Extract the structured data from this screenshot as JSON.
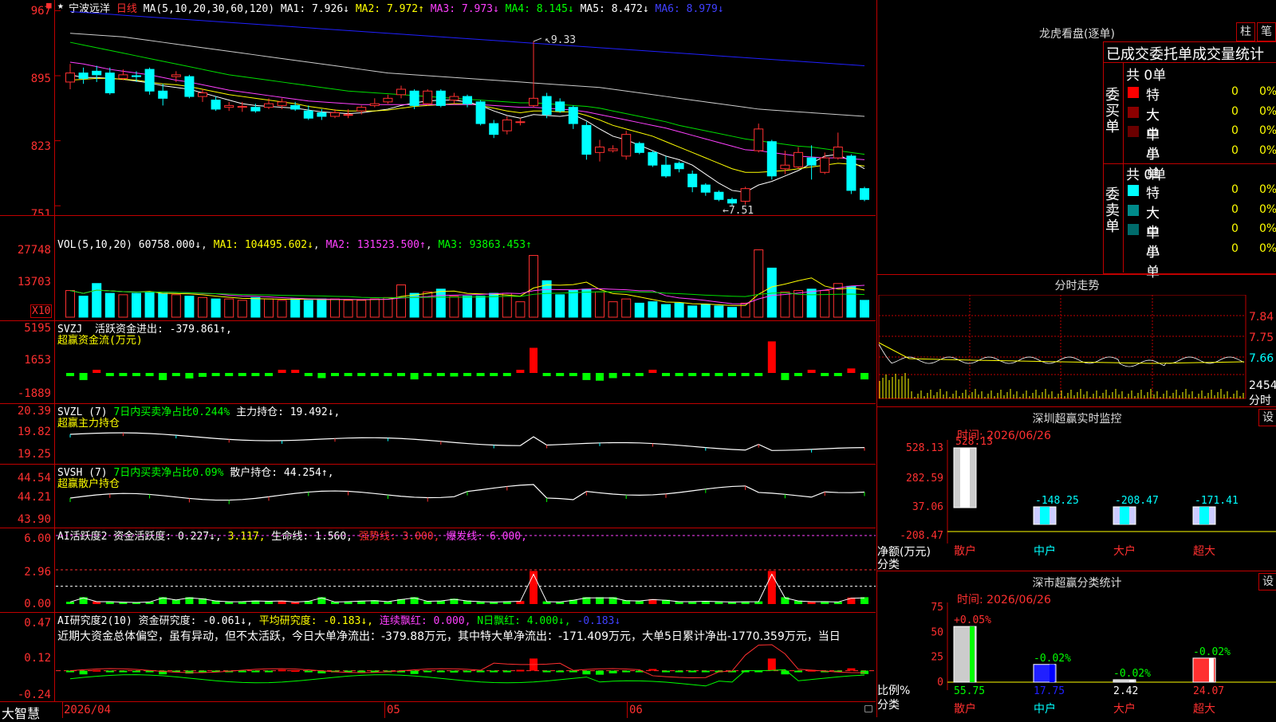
{
  "stock": {
    "name": "宁波远洋",
    "period": "日线"
  },
  "main": {
    "ma_label": "MA(5,10,20,30,60,120)",
    "ma1": "MA1: 7.926↓",
    "ma2": "MA2: 7.972↑",
    "ma3": "MA3: 7.973↓",
    "ma4": "MA4: 8.145↓",
    "ma5": "MA5: 8.472↓",
    "ma6": "MA6: 8.979↓",
    "yticks": [
      "967",
      "895",
      "823",
      "751"
    ],
    "high_label": "9.33",
    "low_label": "7.51"
  },
  "vol": {
    "label": "VOL(5,10,20)",
    "value": "60758.000↓",
    "ma1": "MA1: 104495.602↓",
    "ma2": "MA2: 131523.500↑",
    "ma3": "MA3: 93863.453↑",
    "yticks": [
      "27748",
      "13703"
    ],
    "unit": "X10"
  },
  "svzj": {
    "label": "SVZJ",
    "text": "活跃资金进出: -379.861↑,",
    "sub": "超赢资金流(万元)",
    "yticks": [
      "5195",
      "1653",
      "-1889"
    ]
  },
  "svzl": {
    "label": "SVZL (7)",
    "text1": "7日内买卖净占比0.244%",
    "text2": "主力持仓: 19.492↓,",
    "sub": "超赢主力持仓",
    "yticks": [
      "20.39",
      "19.82",
      "19.25"
    ]
  },
  "svsh": {
    "label": "SVSH (7)",
    "text1": "7日内买卖净占比0.09%",
    "text2": "散户持仓: 44.254↑,",
    "sub": "超赢散户持仓",
    "yticks": [
      "44.54",
      "44.21",
      "43.90"
    ]
  },
  "ai_active": {
    "label": "AI活跃度2",
    "t1": "资金活跃度: 0.227↓,",
    "t2": "3.117,",
    "t3": "生命线: 1.560,",
    "t4": "强势线: 3.000,",
    "t5": "爆发线: 6.000,",
    "yticks": [
      "6.00",
      "2.96",
      "0.00"
    ]
  },
  "ai_research": {
    "label": "AI研究度2(10)",
    "t1": "资金研究度: -0.061↓,",
    "t2": "平均研究度: -0.183↓,",
    "t3": "连续飘红: 0.000,",
    "t4": "N日飘红: 4.000↓,",
    "t5": "-0.183↓",
    "text": "近期大资金总体偏空，虽有异动，但不太活跃，今日大单净流出：-379.88万元，其中特大单净流出：-171.409万元，大单5日累计净出-1770.359万元，当日",
    "yticks": [
      "0.47",
      "0.12",
      "-0.24"
    ]
  },
  "xaxis": {
    "brand": "大智慧",
    "labels": [
      "2026/04",
      "05",
      "06"
    ]
  },
  "longhu": {
    "title": "龙虎看盘(逐单)",
    "btn1": "柱",
    "btn2": "笔",
    "subtitle": "已成交委托单成交量统计",
    "buy": {
      "side": "委买单",
      "total": "共 0单",
      "rows": [
        {
          "label": "特大",
          "count": "0",
          "pct": "0%",
          "color": "#ff0000"
        },
        {
          "label": "大单",
          "count": "0",
          "pct": "0%",
          "color": "#8b0000"
        },
        {
          "label": "中单",
          "count": "0",
          "pct": "0%",
          "color": "#6a0000"
        },
        {
          "label": "小单",
          "count": "0",
          "pct": "0%",
          "color": "#000000"
        }
      ]
    },
    "sell": {
      "side": "委卖单",
      "total": "共 0单",
      "rows": [
        {
          "label": "特大",
          "count": "0",
          "pct": "0%",
          "color": "#00ffff"
        },
        {
          "label": "大单",
          "count": "0",
          "pct": "0%",
          "color": "#008b8b"
        },
        {
          "label": "中单",
          "count": "0",
          "pct": "0%",
          "color": "#006b6b"
        },
        {
          "label": "小单",
          "count": "0",
          "pct": "0%",
          "color": "#000000"
        }
      ]
    }
  },
  "fenshi": {
    "title": "分时走势",
    "yticks": [
      "7.84",
      "7.75",
      "7.66"
    ],
    "vol_tick": "2454",
    "time_label": "分时"
  },
  "monitor": {
    "title": "深圳超赢实时监控",
    "btn": "设",
    "time": "时间: 2026/06/26",
    "yticks": [
      "528.13",
      "282.59",
      "37.06",
      "-208.47"
    ],
    "ylabel": "净额(万元)",
    "xlabel": "分类",
    "categories": [
      "散户",
      "中户",
      "大户",
      "超大"
    ],
    "values": [
      "528.13",
      "-148.25",
      "-208.47",
      "-171.41"
    ]
  },
  "classify": {
    "title": "深市超赢分类统计",
    "btn": "设",
    "time": "时间: 2026/06/26",
    "yticks": [
      "75",
      "50",
      "25",
      "0"
    ],
    "ylabel": "比例%",
    "xlabel": "分类",
    "categories": [
      "散户",
      "中户",
      "大户",
      "超大"
    ],
    "changes": [
      "+0.05%",
      "-0.02%",
      "-0.02%",
      "-0.02%"
    ],
    "values": [
      "55.75",
      "17.75",
      "2.42",
      "24.07"
    ]
  },
  "chart_data": {
    "type": "candlestick",
    "title": "宁波远洋 日线",
    "xlabels": [
      "2026/04",
      "05",
      "06"
    ],
    "ylim": [
      7.45,
      9.7
    ],
    "candles": [
      [
        8.88,
        8.98,
        9.08,
        8.8
      ],
      [
        8.98,
        8.92,
        9.04,
        8.86
      ],
      [
        9.0,
        8.96,
        9.06,
        8.88
      ],
      [
        8.98,
        8.76,
        9.04,
        8.74
      ],
      [
        8.92,
        8.96,
        9.02,
        8.9
      ],
      [
        8.95,
        8.94,
        9.0,
        8.88
      ],
      [
        9.02,
        8.78,
        9.04,
        8.74
      ],
      [
        8.78,
        8.7,
        8.86,
        8.62
      ],
      [
        8.94,
        8.96,
        9.0,
        8.88
      ],
      [
        8.94,
        8.72,
        8.96,
        8.7
      ],
      [
        8.72,
        8.76,
        8.8,
        8.66
      ],
      [
        8.68,
        8.58,
        8.72,
        8.56
      ],
      [
        8.6,
        8.62,
        8.66,
        8.56
      ],
      [
        8.6,
        8.61,
        8.66,
        8.55
      ],
      [
        8.6,
        8.56,
        8.64,
        8.54
      ],
      [
        8.6,
        8.64,
        8.7,
        8.58
      ],
      [
        8.62,
        8.66,
        8.7,
        8.58
      ],
      [
        8.62,
        8.58,
        8.66,
        8.56
      ],
      [
        8.56,
        8.48,
        8.62,
        8.46
      ],
      [
        8.54,
        8.5,
        8.58,
        8.46
      ],
      [
        8.5,
        8.54,
        8.58,
        8.48
      ],
      [
        8.52,
        8.52,
        8.58,
        8.48
      ],
      [
        8.56,
        8.6,
        8.62,
        8.52
      ],
      [
        8.62,
        8.64,
        8.7,
        8.6
      ],
      [
        8.66,
        8.7,
        8.74,
        8.64
      ],
      [
        8.74,
        8.8,
        8.84,
        8.7
      ],
      [
        8.78,
        8.62,
        8.8,
        8.58
      ],
      [
        8.64,
        8.78,
        8.8,
        8.62
      ],
      [
        8.78,
        8.62,
        8.8,
        8.6
      ],
      [
        8.68,
        8.72,
        8.76,
        8.64
      ],
      [
        8.72,
        8.64,
        8.74,
        8.6
      ],
      [
        8.66,
        8.42,
        8.68,
        8.4
      ],
      [
        8.42,
        8.3,
        8.46,
        8.26
      ],
      [
        8.34,
        8.46,
        8.5,
        8.3
      ],
      [
        8.44,
        8.44,
        8.48,
        8.4
      ],
      [
        8.62,
        8.7,
        9.33,
        8.6
      ],
      [
        8.72,
        8.52,
        8.76,
        8.48
      ],
      [
        8.66,
        8.56,
        8.7,
        8.54
      ],
      [
        8.6,
        8.42,
        8.62,
        8.36
      ],
      [
        8.4,
        8.08,
        8.44,
        8.02
      ],
      [
        8.1,
        8.16,
        8.24,
        8.0
      ],
      [
        8.12,
        8.14,
        8.18,
        8.1
      ],
      [
        8.06,
        8.3,
        8.34,
        8.02
      ],
      [
        8.2,
        8.1,
        8.22,
        8.08
      ],
      [
        8.1,
        7.96,
        8.12,
        7.94
      ],
      [
        7.96,
        7.84,
        8.06,
        7.82
      ],
      [
        7.98,
        7.92,
        8.0,
        7.88
      ],
      [
        7.86,
        7.72,
        7.9,
        7.66
      ],
      [
        7.74,
        7.66,
        7.76,
        7.62
      ],
      [
        7.66,
        7.58,
        7.68,
        7.56
      ],
      [
        7.58,
        7.54,
        7.6,
        7.51
      ],
      [
        7.56,
        7.7,
        7.72,
        7.52
      ],
      [
        8.12,
        8.36,
        8.42,
        8.1
      ],
      [
        8.22,
        7.84,
        8.24,
        7.8
      ],
      [
        7.92,
        7.96,
        8.12,
        7.86
      ],
      [
        7.94,
        8.1,
        8.16,
        7.92
      ],
      [
        8.04,
        7.96,
        8.18,
        7.8
      ],
      [
        7.88,
        8.04,
        8.1,
        7.86
      ],
      [
        8.04,
        8.16,
        8.32,
        8.02
      ],
      [
        8.06,
        7.68,
        8.08,
        7.64
      ],
      [
        7.7,
        7.58,
        7.72,
        7.56
      ]
    ],
    "ma_series": [
      {
        "name": "MA1",
        "color": "#ffffff",
        "values": [
          8.96,
          8.93,
          8.93,
          8.92,
          8.91,
          8.89,
          8.87,
          8.84,
          8.82,
          8.8,
          8.76,
          8.72,
          8.68,
          8.64,
          8.62,
          8.61,
          8.6,
          8.59,
          8.57,
          8.55,
          8.54,
          8.53,
          8.54,
          8.56,
          8.58,
          8.62,
          8.65,
          8.67,
          8.68,
          8.68,
          8.66,
          8.62,
          8.56,
          8.51,
          8.48,
          8.52,
          8.51,
          8.5,
          8.52,
          8.45,
          8.36,
          8.28,
          8.24,
          8.18,
          8.12,
          8.06,
          8.02,
          7.96,
          7.86,
          7.76,
          7.68,
          7.66,
          7.74,
          7.78,
          7.84,
          7.9,
          7.98,
          8.06,
          8.08,
          8.0,
          7.92
        ]
      },
      {
        "name": "MA2",
        "color": "#ffff00",
        "values": [
          8.9,
          8.91,
          8.92,
          8.92,
          8.91,
          8.9,
          8.88,
          8.86,
          8.85,
          8.83,
          8.8,
          8.77,
          8.74,
          8.72,
          8.7,
          8.68,
          8.66,
          8.64,
          8.61,
          8.59,
          8.57,
          8.56,
          8.56,
          8.56,
          8.57,
          8.59,
          8.61,
          8.62,
          8.63,
          8.64,
          8.64,
          8.62,
          8.59,
          8.56,
          8.54,
          8.56,
          8.56,
          8.55,
          8.55,
          8.51,
          8.46,
          8.4,
          8.36,
          8.32,
          8.28,
          8.22,
          8.16,
          8.1,
          8.04,
          7.98,
          7.92,
          7.88,
          7.88,
          7.89,
          7.9,
          7.92,
          7.94,
          7.96,
          7.98,
          7.97,
          7.95
        ]
      },
      {
        "name": "MA3",
        "color": "#ff40ff",
        "values": [
          9.1,
          9.08,
          9.05,
          9.02,
          9.0,
          8.98,
          8.96,
          8.93,
          8.9,
          8.88,
          8.85,
          8.82,
          8.79,
          8.77,
          8.75,
          8.73,
          8.71,
          8.69,
          8.67,
          8.66,
          8.65,
          8.64,
          8.63,
          8.63,
          8.63,
          8.63,
          8.63,
          8.63,
          8.63,
          8.63,
          8.63,
          8.63,
          8.62,
          8.61,
          8.6,
          8.6,
          8.59,
          8.58,
          8.57,
          8.55,
          8.52,
          8.49,
          8.46,
          8.43,
          8.4,
          8.37,
          8.33,
          8.29,
          8.25,
          8.21,
          8.17,
          8.13,
          8.12,
          8.1,
          8.08,
          8.06,
          8.05,
          8.04,
          8.04,
          8.03,
          8.02
        ]
      },
      {
        "name": "MA4",
        "color": "#00dd00",
        "values": [
          9.32,
          9.29,
          9.26,
          9.23,
          9.2,
          9.17,
          9.14,
          9.11,
          9.08,
          9.05,
          9.02,
          8.99,
          8.96,
          8.94,
          8.92,
          8.9,
          8.88,
          8.86,
          8.84,
          8.82,
          8.8,
          8.78,
          8.77,
          8.76,
          8.75,
          8.74,
          8.73,
          8.72,
          8.71,
          8.7,
          8.69,
          8.68,
          8.67,
          8.66,
          8.65,
          8.65,
          8.64,
          8.63,
          8.62,
          8.61,
          8.59,
          8.56,
          8.53,
          8.5,
          8.47,
          8.44,
          8.4,
          8.37,
          8.34,
          8.31,
          8.28,
          8.25,
          8.23,
          8.21,
          8.19,
          8.17,
          8.16,
          8.14,
          8.12,
          8.1,
          8.08
        ]
      },
      {
        "name": "MA5",
        "color": "#cccccc",
        "values": [
          9.42,
          9.41,
          9.4,
          9.39,
          9.38,
          9.36,
          9.34,
          9.32,
          9.3,
          9.28,
          9.26,
          9.24,
          9.22,
          9.2,
          9.18,
          9.16,
          9.14,
          9.12,
          9.1,
          9.08,
          9.06,
          9.04,
          9.02,
          9.0,
          8.98,
          8.97,
          8.96,
          8.95,
          8.94,
          8.93,
          8.92,
          8.91,
          8.9,
          8.89,
          8.88,
          8.87,
          8.86,
          8.85,
          8.84,
          8.83,
          8.82,
          8.8,
          8.78,
          8.76,
          8.74,
          8.72,
          8.7,
          8.68,
          8.66,
          8.64,
          8.62,
          8.6,
          8.58,
          8.57,
          8.56,
          8.55,
          8.54,
          8.53,
          8.52,
          8.51,
          8.5
        ]
      },
      {
        "name": "MA6",
        "color": "#2020ff",
        "values": [
          9.66,
          9.65,
          9.64,
          9.63,
          9.62,
          9.61,
          9.6,
          9.59,
          9.58,
          9.57,
          9.56,
          9.55,
          9.54,
          9.53,
          9.52,
          9.51,
          9.5,
          9.49,
          9.48,
          9.47,
          9.46,
          9.45,
          9.44,
          9.43,
          9.42,
          9.41,
          9.4,
          9.39,
          9.38,
          9.37,
          9.36,
          9.35,
          9.34,
          9.33,
          9.32,
          9.31,
          9.3,
          9.29,
          9.28,
          9.27,
          9.26,
          9.25,
          9.24,
          9.23,
          9.22,
          9.21,
          9.2,
          9.19,
          9.18,
          9.17,
          9.16,
          9.15,
          9.14,
          9.13,
          9.12,
          9.11,
          9.1,
          9.09,
          9.08,
          9.07,
          9.06
        ]
      }
    ],
    "volume": [
      1900,
      1500,
      2400,
      1700,
      1600,
      1700,
      1800,
      1700,
      1600,
      1500,
      1400,
      1300,
      1300,
      1200,
      1400,
      1300,
      1200,
      1300,
      1200,
      1300,
      1300,
      1200,
      1200,
      1300,
      1400,
      2300,
      1700,
      1800,
      2000,
      1500,
      1500,
      1500,
      1700,
      1700,
      1100,
      4400,
      2600,
      1600,
      1900,
      2000,
      1800,
      1100,
      1300,
      1000,
      1100,
      900,
      1000,
      800,
      900,
      800,
      700,
      1000,
      4800,
      3500,
      1800,
      1900,
      2000,
      1900,
      2400,
      2200,
      1200
    ],
    "fund_flow": [
      -150,
      -1100,
      200,
      -200,
      -120,
      -80,
      -150,
      -1100,
      -450,
      -850,
      -600,
      -300,
      -180,
      -200,
      -300,
      -250,
      300,
      150,
      -250,
      -800,
      -150,
      -200,
      -280,
      -350,
      -200,
      -500,
      -1000,
      -250,
      -300,
      -550,
      -300,
      -200,
      -150,
      -200,
      250,
      3900,
      -200,
      -150,
      -400,
      -1100,
      -1200,
      -800,
      -350,
      -300,
      500,
      -400,
      -200,
      -200,
      -250,
      -200,
      -150,
      -180,
      -200,
      4900,
      -1100,
      -300,
      200,
      -200,
      -150,
      700,
      -1000,
      -380
    ]
  }
}
